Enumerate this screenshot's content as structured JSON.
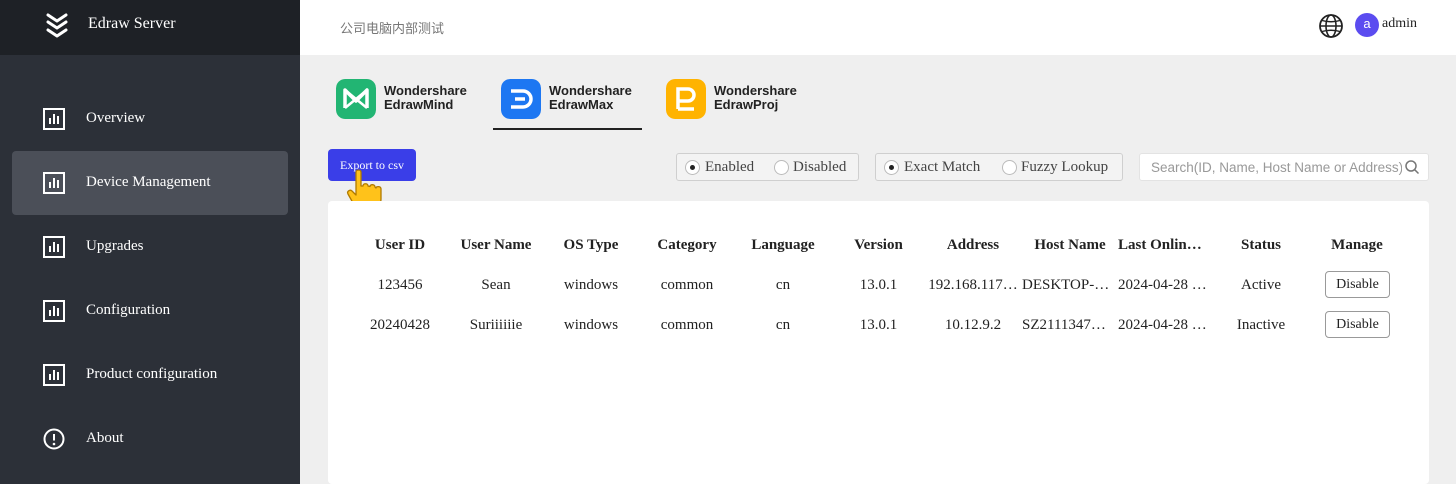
{
  "app": {
    "name": "Edraw Server"
  },
  "sidebar": {
    "items": [
      {
        "label": "Overview",
        "icon": "chart-bar-icon"
      },
      {
        "label": "Device Management",
        "icon": "chart-bar-icon",
        "active": true
      },
      {
        "label": "Upgrades",
        "icon": "chart-bar-icon"
      },
      {
        "label": "Configuration",
        "icon": "chart-bar-icon"
      },
      {
        "label": "Product configuration",
        "icon": "chart-bar-icon"
      },
      {
        "label": "About",
        "icon": "info-circle-icon"
      }
    ]
  },
  "header": {
    "title": "公司电脑内部测试",
    "avatar_initial": "a",
    "username": "admin",
    "icons": [
      "globe-icon"
    ]
  },
  "products": [
    {
      "line1": "Wondershare",
      "line2": "EdrawMind",
      "color": "#22b573",
      "icon": "edrawmind-logo-icon"
    },
    {
      "line1": "Wondershare",
      "line2": "EdrawMax",
      "color": "#1d77f2",
      "icon": "edrawmax-logo-icon",
      "active": true
    },
    {
      "line1": "Wondershare",
      "line2": "EdrawProj",
      "color": "#ffb300",
      "icon": "edrawproj-logo-icon"
    }
  ],
  "toolbar": {
    "export_label": "Export to csv",
    "status_filter": {
      "options": [
        "Enabled",
        "Disabled"
      ],
      "selected": "Enabled"
    },
    "match_filter": {
      "options": [
        "Exact Match",
        "Fuzzy Lookup"
      ],
      "selected": "Exact Match"
    },
    "search": {
      "placeholder": "Search(ID, Name, Host Name or Address)",
      "value": ""
    }
  },
  "table": {
    "columns": [
      "User ID",
      "User Name",
      "OS Type",
      "Category",
      "Language",
      "Version",
      "Address",
      "Host Name",
      "Last Onlin…",
      "Status",
      "Manage"
    ],
    "rows": [
      {
        "user_id": "123456",
        "user_name": "Sean",
        "os_type": "windows",
        "category": "common",
        "language": "cn",
        "version": "13.0.1",
        "address": "192.168.117…",
        "host_name": "DESKTOP-…",
        "last_online": "2024-04-28 …",
        "status": "Active",
        "action": "Disable"
      },
      {
        "user_id": "20240428",
        "user_name": "Suriiiiiie",
        "os_type": "windows",
        "category": "common",
        "language": "cn",
        "version": "13.0.1",
        "address": "10.12.9.2",
        "host_name": "SZ2111347…",
        "last_online": "2024-04-28 …",
        "status": "Inactive",
        "action": "Disable"
      }
    ]
  },
  "colors": {
    "sidebar_bg": "#2c3038",
    "brand_bg": "#1e2126",
    "accent": "#3a3ee8",
    "avatar": "#5b4cf0"
  }
}
